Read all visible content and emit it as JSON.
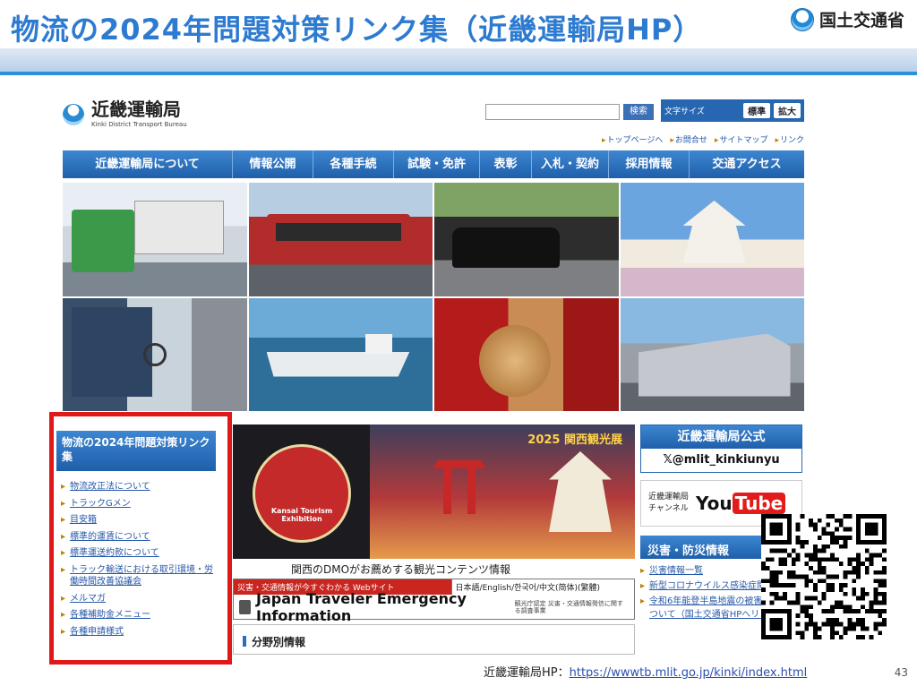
{
  "slide": {
    "title": "物流の2024年問題対策リンク集（近畿運輸局HP）",
    "ministry": "国土交通省",
    "page_number": "43",
    "footer_label": "近畿運輸局HP：",
    "footer_url": "https://wwwtb.mlit.go.jp/kinki/index.html"
  },
  "site": {
    "name": "近畿運輸局",
    "name_en": "Kinki District Transport Bureau",
    "search_button": "検索",
    "font_size_label": "文字サイズ",
    "font_standard": "標準",
    "font_large": "拡大",
    "util_links": [
      "トップページへ",
      "お問合せ",
      "サイトマップ",
      "リンク"
    ],
    "nav": [
      "近畿運輸局について",
      "情報公開",
      "各種手続",
      "試験・免許",
      "表彰",
      "入札・契約",
      "採用情報",
      "交通アクセス"
    ]
  },
  "sidebar": {
    "heading": "物流の2024年問題対策リンク集",
    "items": [
      "物流改正法について",
      "トラックGメン",
      "目安箱",
      "標準的運賃について",
      "標準運送約款について",
      "トラック輸送における取引環境・労働時間改善協議会",
      "メルマガ",
      "各種補助金メニュー",
      "各種申請様式"
    ]
  },
  "center": {
    "banner_a_text": "Kansai Tourism Exhibition",
    "banner_b_title": "2025 関西観光展",
    "dmo_caption": "関西のDMOがお薦めする観光コンテンツ情報",
    "emergency_top_left": "災害・交通情報が今すぐわかる Webサイト",
    "emergency_top_right": "日本語/English/한국어/中文(简体)(繁體)",
    "emergency_title": "Japan Traveler Emergency Information",
    "emergency_note": "観光庁認定 災害・交通情報発信に関する調査事業",
    "field_heading": "分野別情報"
  },
  "right": {
    "official_heading": "近畿運輸局公式",
    "x_handle": "𝕏@mlit_kinkiunyu",
    "youtube_text_1": "近畿運輸局",
    "youtube_text_2": "チャンネル",
    "youtube_logo": "You",
    "youtube_logo_2": "Tube",
    "disaster_heading": "災害・防災情報",
    "disaster_items": [
      "災害情報一覧",
      "新型コロナウイルス感染症関連情報",
      "令和6年能登半島地震の被害と対応について（国土交通省HPへリンク）"
    ]
  },
  "colors": {
    "title_blue": "#2d7bd1",
    "nav_blue": "#1f5faa",
    "highlight_red": "#e01818"
  }
}
